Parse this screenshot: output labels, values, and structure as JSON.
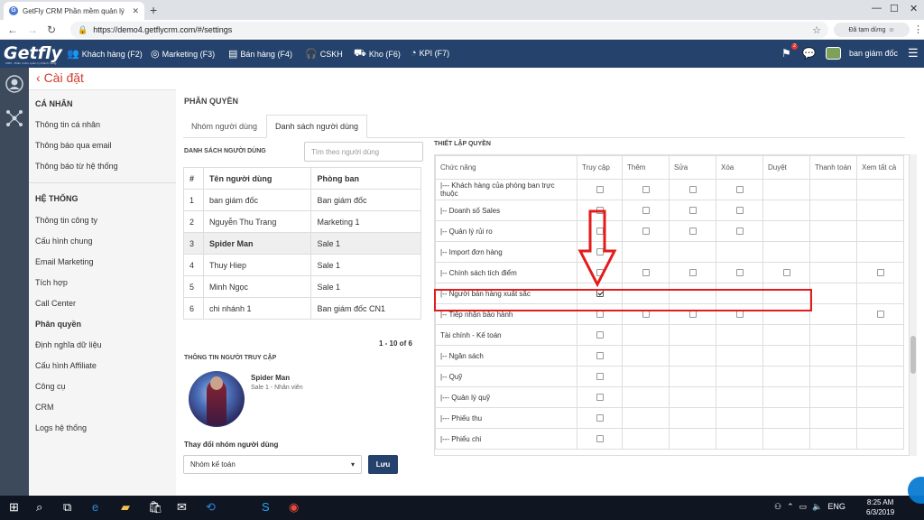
{
  "browser": {
    "tab_title": "GetFly CRM Phần mềm quản lý",
    "url": "https://demo4.getflycrm.com/#/settings",
    "paused_label": "Đã tạm dừng"
  },
  "app": {
    "logo": "Getfly",
    "logo_tagline": "CRM - Phần mềm quản lý khách hàng",
    "menu": [
      {
        "label": "Khách hàng (F2)",
        "icon": "users-icon"
      },
      {
        "label": "Marketing (F3)",
        "icon": "target-icon"
      },
      {
        "label": "Bán hàng (F4)",
        "icon": "cash-register-icon"
      },
      {
        "label": "CSKH",
        "icon": "headset-icon"
      },
      {
        "label": "Kho (F6)",
        "icon": "forklift-icon"
      },
      {
        "label": "KPI (F7)",
        "icon": "gauge-icon"
      }
    ],
    "notification_count": "2",
    "user_name": "ban giám đốc"
  },
  "page": {
    "title": "Cài đặt"
  },
  "sidebar": {
    "personal_heading": "CÁ NHÂN",
    "personal_items": [
      "Thông tin cá nhân",
      "Thông báo qua email",
      "Thông báo từ hệ thống"
    ],
    "system_heading": "HỆ THỐNG",
    "system_items": [
      "Thông tin công ty",
      "Cấu hình chung",
      "Email Marketing",
      "Tích hợp",
      "Call Center",
      "Phân quyền",
      "Định nghĩa dữ liệu",
      "Cấu hình Affiliate",
      "Công cụ",
      "CRM",
      "Logs hệ thống"
    ],
    "active_item": "Phân quyền"
  },
  "permissions": {
    "title": "PHÂN QUYỀN",
    "tabs": [
      "Nhóm người dùng",
      "Danh sách người dùng"
    ],
    "active_tab": "Danh sách người dùng",
    "user_list_title": "DANH SÁCH NGƯỜI DÙNG",
    "search_placeholder": "Tìm theo người dùng",
    "user_table": {
      "headers": [
        "#",
        "Tên người dùng",
        "Phòng ban"
      ],
      "rows": [
        [
          "1",
          "ban giám đốc",
          "Ban giám đốc"
        ],
        [
          "2",
          "Nguyễn Thu Trang",
          "Marketing 1"
        ],
        [
          "3",
          "Spider Man",
          "Sale 1"
        ],
        [
          "4",
          "Thuy Hiep",
          "Sale 1"
        ],
        [
          "5",
          "Minh Ngọc",
          "Sale 1"
        ],
        [
          "6",
          "chi nhánh 1",
          "Ban giám đốc CN1"
        ]
      ],
      "selected_row": 3
    },
    "pagination": "1 - 10 of 6",
    "access_info_title": "THÔNG TIN NGƯỜI TRUY CẬP",
    "access_user": {
      "name": "Spider Man",
      "role": "Sale 1 - Nhân viên"
    },
    "change_group_label": "Thay đổi nhóm người dùng",
    "group_selected": "Nhóm kế toán",
    "save_label": "Lưu",
    "grid_title": "THIẾT LẬP QUYỀN",
    "grid_headers": [
      "Chức năng",
      "Truy cập",
      "Thêm",
      "Sửa",
      "Xóa",
      "Duyệt",
      "Thanh toán",
      "Xem tất cả"
    ],
    "grid_rows": [
      {
        "name": "|--- Khách hàng của phòng ban trực thuộc",
        "cells": [
          0,
          0,
          0,
          0,
          -1,
          -1,
          -1
        ]
      },
      {
        "name": "|-- Doanh số Sales",
        "cells": [
          0,
          0,
          0,
          0,
          -1,
          -1,
          -1
        ]
      },
      {
        "name": "|-- Quản lý rủi ro",
        "cells": [
          0,
          0,
          0,
          0,
          -1,
          -1,
          -1
        ]
      },
      {
        "name": "|-- Import đơn hàng",
        "cells": [
          0,
          -1,
          -1,
          -1,
          -1,
          -1,
          -1
        ]
      },
      {
        "name": "|-- Chính sách tích điểm",
        "cells": [
          0,
          0,
          0,
          0,
          0,
          -1,
          0
        ]
      },
      {
        "name": "|-- Người bán hàng xuất sắc",
        "cells": [
          1,
          -1,
          -1,
          -1,
          -1,
          -1,
          -1
        ]
      },
      {
        "name": "|-- Tiếp nhận bảo hành",
        "cells": [
          0,
          0,
          0,
          0,
          -1,
          -1,
          0
        ]
      },
      {
        "name": "Tài chính - Kế toán",
        "cells": [
          0,
          -1,
          -1,
          -1,
          -1,
          -1,
          -1
        ]
      },
      {
        "name": "|-- Ngân sách",
        "cells": [
          0,
          -1,
          -1,
          -1,
          -1,
          -1,
          -1
        ]
      },
      {
        "name": "|-- Quỹ",
        "cells": [
          0,
          -1,
          -1,
          -1,
          -1,
          -1,
          -1
        ]
      },
      {
        "name": "|--- Quản lý quỹ",
        "cells": [
          0,
          -1,
          -1,
          -1,
          -1,
          -1,
          -1
        ]
      },
      {
        "name": "|--- Phiếu thu",
        "cells": [
          0,
          -1,
          -1,
          -1,
          -1,
          -1,
          -1
        ]
      },
      {
        "name": "|--- Phiếu chi",
        "cells": [
          0,
          -1,
          -1,
          -1,
          -1,
          -1,
          -1
        ]
      }
    ],
    "highlighted_row": "|-- Người bán hàng xuất sắc"
  },
  "taskbar": {
    "language": "ENG",
    "time": "8:25 AM",
    "date": "6/3/2019"
  },
  "colors": {
    "topbar": "#24426b",
    "accent_red": "#e41b1b",
    "page_title": "#d03c2f"
  }
}
